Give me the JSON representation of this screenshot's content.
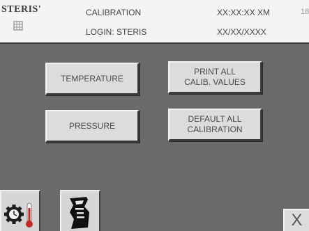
{
  "header": {
    "logo_text": "STERIS'",
    "title": "CALIBRATION",
    "login": "LOGIN: STERIS",
    "time": "XX:XX:XX XM",
    "date": "XX/XX/XXXX",
    "cut_number": "18"
  },
  "buttons": {
    "temperature": "TEMPERATURE",
    "print_all": "PRINT ALL\nCALIB. VALUES",
    "pressure": "PRESSURE",
    "default_all": "DEFAULT ALL\nCALIBRATION"
  },
  "toolbar": {
    "calibrate_icon": "gear-thermometer-icon",
    "document_icon": "document-icon",
    "exit_label": "X"
  },
  "colors": {
    "background": "#6a6a6a",
    "header_background": "#f4f4f4",
    "button_face": "#dcdcdc"
  }
}
